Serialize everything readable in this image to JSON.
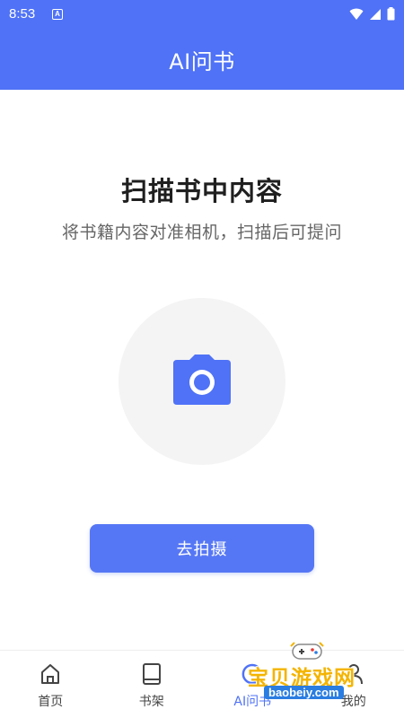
{
  "status_bar": {
    "time": "8:53",
    "notification_icon": "a-letter-icon",
    "icons": [
      "wifi-icon",
      "signal-icon",
      "battery-icon"
    ]
  },
  "header": {
    "title": "AI问书"
  },
  "main": {
    "title": "扫描书中内容",
    "subtitle": "将书籍内容对准相机，扫描后可提问",
    "camera_icon": "camera-icon",
    "capture_button_label": "去拍摄"
  },
  "bottom_nav": {
    "items": [
      {
        "label": "首页",
        "icon": "home-icon",
        "active": false
      },
      {
        "label": "书架",
        "icon": "book-icon",
        "active": false
      },
      {
        "label": "AI问书",
        "icon": "ai-icon",
        "active": true
      },
      {
        "label": "我的",
        "icon": "user-icon",
        "active": false
      }
    ]
  },
  "watermark": {
    "text": "宝贝游戏网",
    "url": "baobeiy.com"
  },
  "colors": {
    "primary": "#4f72f6",
    "button": "#5677f5",
    "circle_bg": "#f4f4f4"
  }
}
